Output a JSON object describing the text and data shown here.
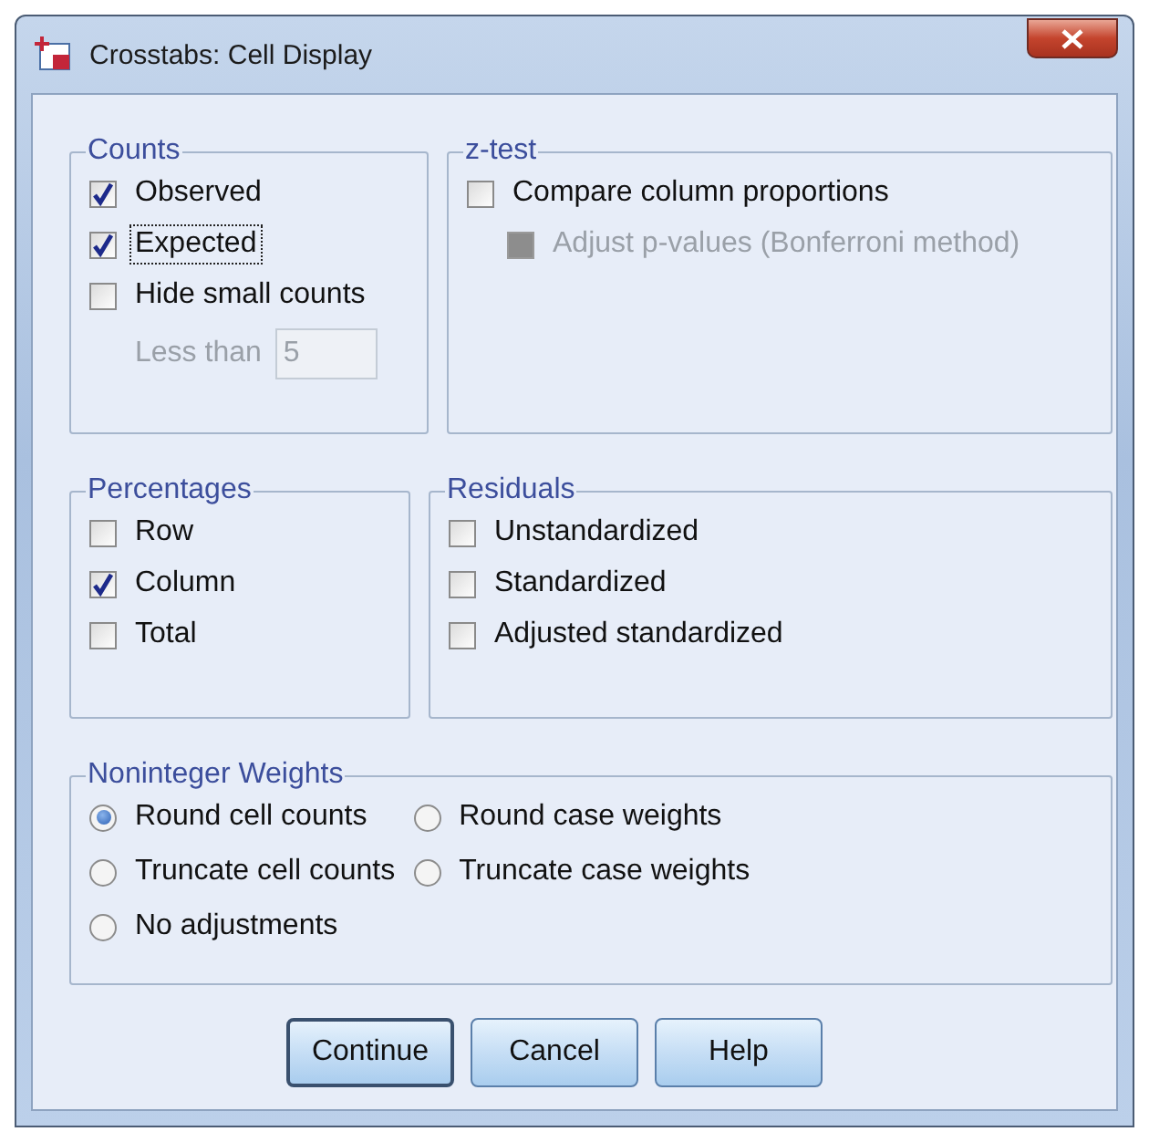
{
  "window": {
    "title": "Crosstabs: Cell Display"
  },
  "top_groups": [
    {
      "title": "Counts",
      "options": [
        {
          "kind": "checkbox",
          "label": "Observed",
          "checked": true,
          "disabled": false,
          "focused": false
        },
        {
          "kind": "checkbox",
          "label": "Expected",
          "checked": true,
          "disabled": false,
          "focused": true
        },
        {
          "kind": "checkbox",
          "label": "Hide small counts",
          "checked": false,
          "disabled": false,
          "focused": false,
          "children": [
            {
              "kind": "field",
              "label": "Less than",
              "value": "5",
              "disabled": true
            }
          ]
        }
      ]
    },
    {
      "title": "z-test",
      "options": [
        {
          "kind": "checkbox",
          "label": "Compare column proportions",
          "checked": false,
          "disabled": false,
          "focused": false,
          "children": [
            {
              "kind": "checkbox",
              "label": "Adjust p-values (Bonferroni method)",
              "checked": false,
              "disabled": true,
              "focused": false
            }
          ]
        }
      ]
    }
  ],
  "middle_groups": [
    {
      "title": "Percentages",
      "options": [
        {
          "kind": "checkbox",
          "label": "Row",
          "checked": false,
          "disabled": false,
          "focused": false
        },
        {
          "kind": "checkbox",
          "label": "Column",
          "checked": true,
          "disabled": false,
          "focused": false
        },
        {
          "kind": "checkbox",
          "label": "Total",
          "checked": false,
          "disabled": false,
          "focused": false
        }
      ]
    },
    {
      "title": "Residuals",
      "options": [
        {
          "kind": "checkbox",
          "label": "Unstandardized",
          "checked": false,
          "disabled": false,
          "focused": false
        },
        {
          "kind": "checkbox",
          "label": "Standardized",
          "checked": false,
          "disabled": false,
          "focused": false
        },
        {
          "kind": "checkbox",
          "label": "Adjusted standardized",
          "checked": false,
          "disabled": false,
          "focused": false
        }
      ]
    }
  ],
  "weights": {
    "title": "Noninteger Weights",
    "options": [
      {
        "label": "Round cell counts",
        "selected": true
      },
      {
        "label": "Round case weights",
        "selected": false
      },
      {
        "label": "Truncate cell counts",
        "selected": false
      },
      {
        "label": "Truncate case weights",
        "selected": false
      },
      {
        "label": "No adjustments",
        "selected": false
      }
    ]
  },
  "buttons": [
    {
      "label": "Continue",
      "default": true
    },
    {
      "label": "Cancel",
      "default": false
    },
    {
      "label": "Help",
      "default": false
    }
  ]
}
